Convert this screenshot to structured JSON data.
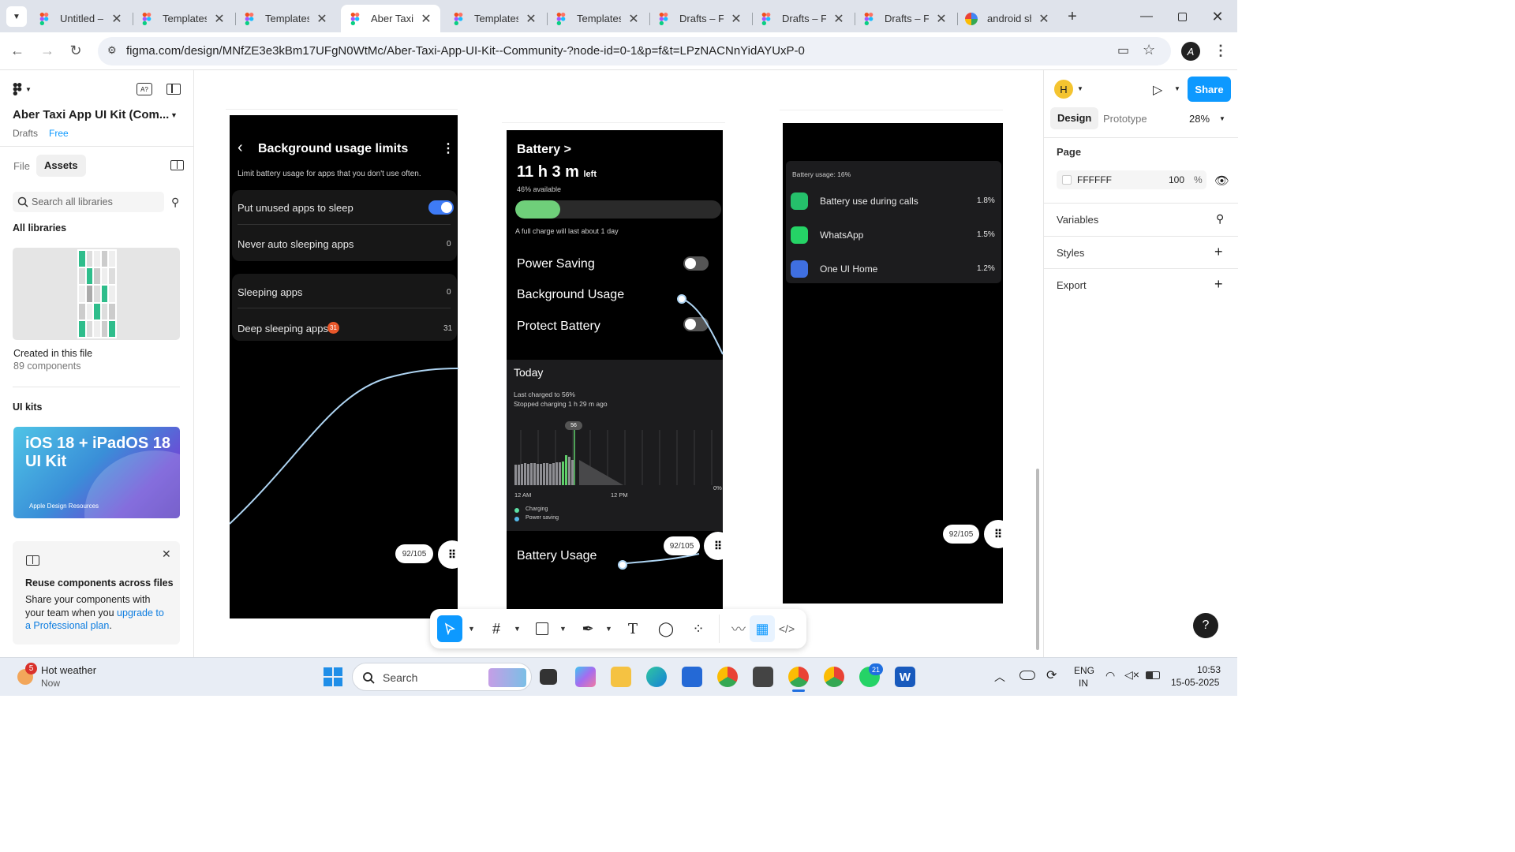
{
  "browser": {
    "tabs": [
      {
        "label": "Untitled – I",
        "icon": "figma-icon"
      },
      {
        "label": "Templates",
        "icon": "figma-icon"
      },
      {
        "label": "Templates",
        "icon": "figma-icon"
      },
      {
        "label": "Aber Taxi A",
        "icon": "figma-icon",
        "active": true
      },
      {
        "label": "Templates",
        "icon": "figma-icon"
      },
      {
        "label": "Templates",
        "icon": "figma-icon"
      },
      {
        "label": "Drafts – Fi",
        "icon": "figma-icon"
      },
      {
        "label": "Drafts – Fi",
        "icon": "figma-icon"
      },
      {
        "label": "Drafts – Fi",
        "icon": "figma-icon"
      },
      {
        "label": "android sh",
        "icon": "google-icon"
      }
    ],
    "url": "figma.com/design/MNfZE3e3kBm17UFgN0WtMc/Aber-Taxi-App-UI-Kit--Community-?node-id=0-1&p=f&t=LPzNACNnYidAYUxP-0",
    "profile_initial": "A"
  },
  "left": {
    "file_name": "Aber Taxi App UI Kit (Com...",
    "project": "Drafts",
    "plan_badge": "Free",
    "tabs": {
      "file": "File",
      "assets": "Assets"
    },
    "search_placeholder": "Search all libraries",
    "all_libraries": "All libraries",
    "created_title": "Created in this file",
    "created_count": "89 components",
    "ui_kits": "UI kits",
    "ios_kit_title": "iOS 18 + iPadOS 18 UI Kit",
    "ios_kit_brand": "Apple Design Resources",
    "promo": {
      "title": "Reuse components across files",
      "body": "Share your components with your team when you ",
      "link": "upgrade to a Professional plan",
      "tail": "."
    }
  },
  "screen1": {
    "title": "Background usage limits",
    "subtitle": "Limit battery usage for apps that you don't use often.",
    "put_unused": "Put unused apps to sleep",
    "never_auto": "Never auto sleeping apps",
    "never_auto_count": "0",
    "sleeping": "Sleeping apps",
    "sleeping_count": "0",
    "deep_sleeping": "Deep sleeping apps",
    "deep_badge": "31",
    "deep_count": "31",
    "pill": "92/105"
  },
  "screen2": {
    "title": "Battery >",
    "time_main": "11 h 3 m",
    "time_suffix": "left",
    "available": "46% available",
    "charge_level": 0.46,
    "full_charge": "A full charge will last about 1 day",
    "power_saving": "Power Saving",
    "background_usage": "Background Usage",
    "protect_battery": "Protect Battery",
    "today": "Today",
    "last_charged": "Last charged to 56%",
    "stopped": "Stopped charging 1 h 29 m ago",
    "chart_marker": "56",
    "axis_12am": "12 AM",
    "axis_12pm": "12 PM",
    "axis_0": "0%",
    "legend_charging": "Charging",
    "legend_power": "Power saving",
    "battery_usage": "Battery Usage",
    "pill": "92/105"
  },
  "screen3": {
    "header": "Battery usage: 16%",
    "apps": [
      {
        "name": "Battery use during calls",
        "pct": "1.8%",
        "color": "#25c06b"
      },
      {
        "name": "WhatsApp",
        "pct": "1.5%",
        "color": "#25d366"
      },
      {
        "name": "One UI Home",
        "pct": "1.2%",
        "color": "#3f6fe0"
      }
    ],
    "pill": "92/105"
  },
  "right": {
    "avatar": "H",
    "share": "Share",
    "tab_design": "Design",
    "tab_prototype": "Prototype",
    "zoom": "28%",
    "page": "Page",
    "page_color": "FFFFFF",
    "page_opacity": "100",
    "page_opacity_unit": "%",
    "variables": "Variables",
    "styles": "Styles",
    "export": "Export",
    "help": "?"
  },
  "taskbar": {
    "weather_title": "Hot weather",
    "weather_sub": "Now",
    "weather_badge": "5",
    "search": "Search",
    "whatsapp_badge": "21",
    "lang1": "ENG",
    "lang2": "IN",
    "time": "10:53",
    "date": "15-05-2025"
  },
  "colors": {
    "figma_blue": "#0d99ff",
    "accent_green": "#6fcf7a",
    "toggle_blue": "#3e7bf6"
  }
}
